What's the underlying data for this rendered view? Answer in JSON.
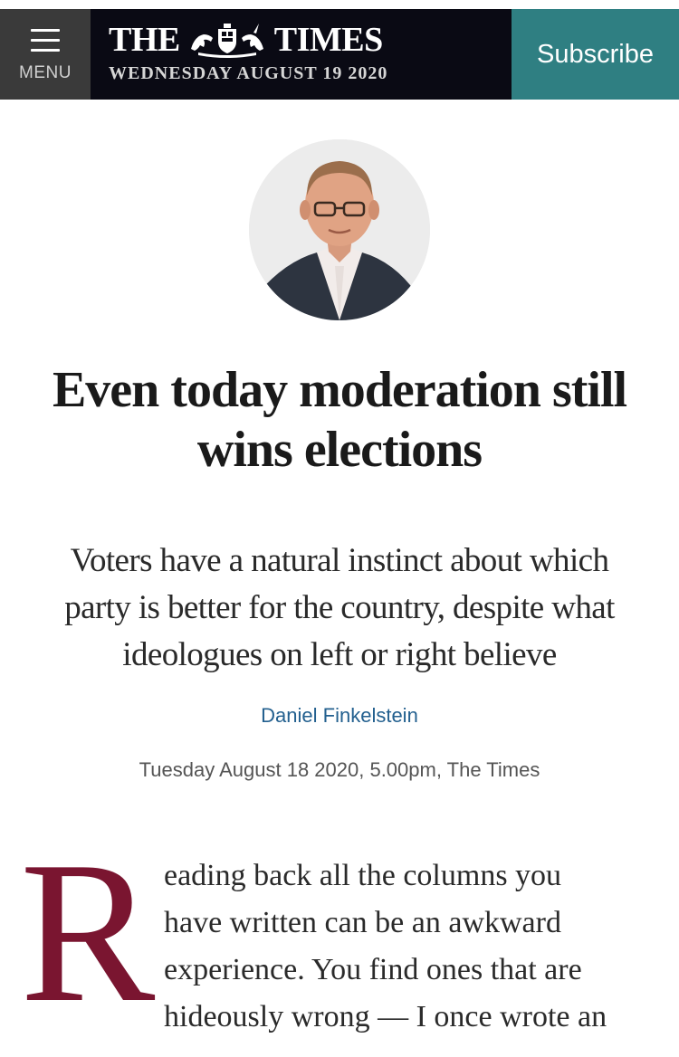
{
  "header": {
    "menu_label": "MENU",
    "logo_left": "THE",
    "logo_right": "TIMES",
    "date": "WEDNESDAY AUGUST 19 2020",
    "subscribe_label": "Subscribe",
    "colors": {
      "bar": "#0a0a14",
      "menu_bg": "#3a3a3a",
      "subscribe_bg": "#2f7f82"
    }
  },
  "article": {
    "headline_lines": [
      "Even today moderation still",
      "wins elections"
    ],
    "standfirst_lines": [
      "Voters have a natural instinct about which",
      "party is better for the country, despite what",
      "ideologues on left or right believe"
    ],
    "author": "Daniel Finkelstein",
    "dateline": "Tuesday August 18 2020, 5.00pm, The Times",
    "dropcap": "R",
    "body_lines": [
      "eading back all the columns you",
      "have written can be an awkward",
      "experience. You find ones that are",
      "hideously wrong — I once wrote an"
    ],
    "colors": {
      "dropcap": "#7a1530",
      "author_link": "#23608f"
    }
  }
}
